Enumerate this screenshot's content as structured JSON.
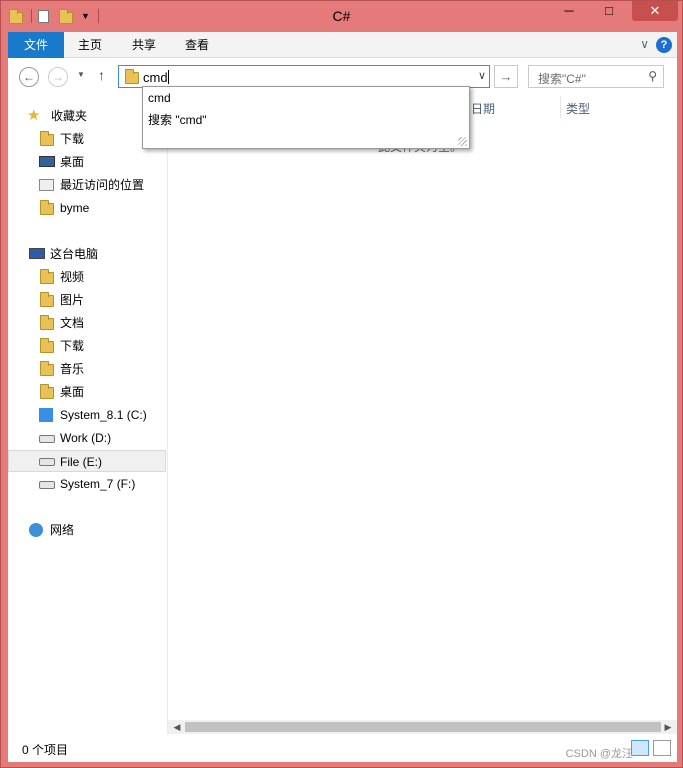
{
  "window": {
    "title": "C#",
    "min_label": "─",
    "max_label": "□",
    "close_label": "✕"
  },
  "ribbon": {
    "tabs": [
      "文件",
      "主页",
      "共享",
      "查看"
    ],
    "help_label": "?"
  },
  "address_bar": {
    "value": "cmd",
    "search_placeholder": "搜索\"C#\""
  },
  "suggestions": [
    "cmd",
    "搜索 \"cmd\""
  ],
  "columns": {
    "date": "日期",
    "type": "类型"
  },
  "empty_hint": "此文件夹为空。",
  "nav": {
    "favorites_label": "收藏夹",
    "favorites": [
      {
        "label": "下载",
        "icon": "download-folder-icon"
      },
      {
        "label": "桌面",
        "icon": "desktop-icon"
      },
      {
        "label": "最近访问的位置",
        "icon": "recent-places-icon"
      },
      {
        "label": "byme",
        "icon": "folder-icon"
      }
    ],
    "this_pc_label": "这台电脑",
    "this_pc": [
      {
        "label": "视频",
        "icon": "video-folder-icon"
      },
      {
        "label": "图片",
        "icon": "pictures-folder-icon"
      },
      {
        "label": "文档",
        "icon": "documents-folder-icon"
      },
      {
        "label": "下载",
        "icon": "download-folder-icon"
      },
      {
        "label": "音乐",
        "icon": "music-folder-icon"
      },
      {
        "label": "桌面",
        "icon": "desktop-folder-icon"
      },
      {
        "label": "System_8.1 (C:)",
        "icon": "windows-drive-icon"
      },
      {
        "label": "Work (D:)",
        "icon": "drive-icon"
      },
      {
        "label": "File (E:)",
        "icon": "drive-icon"
      },
      {
        "label": "System_7 (F:)",
        "icon": "drive-icon"
      }
    ],
    "network_label": "网络"
  },
  "status": {
    "item_count": "0 个项目",
    "watermark": "CSDN @龙汪"
  },
  "colors": {
    "title_bar": "#e47a79",
    "file_tab": "#1979ca",
    "close_button": "#c7504f",
    "address_border": "#3b8ed8"
  }
}
